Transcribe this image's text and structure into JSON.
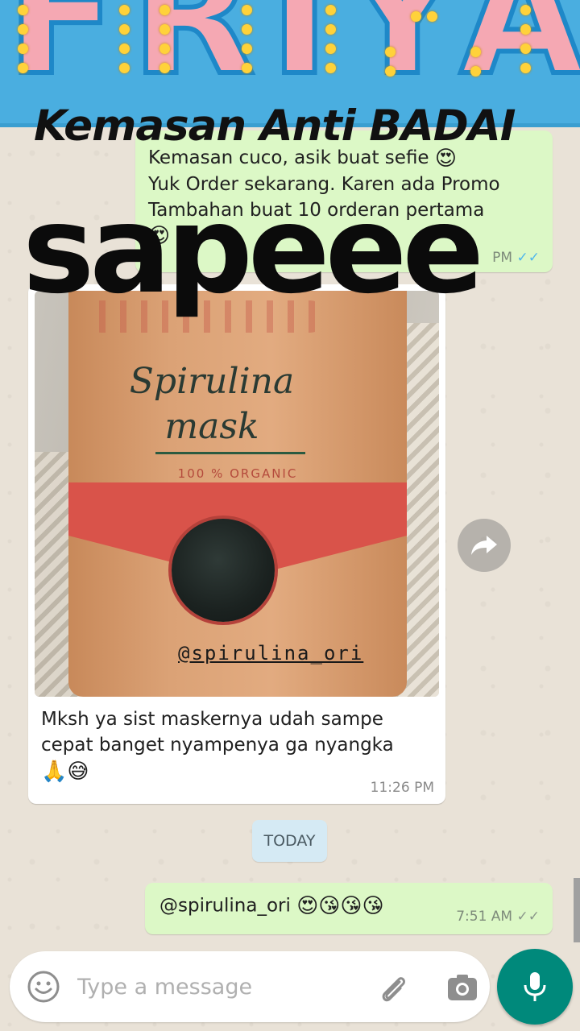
{
  "story": {
    "banner_word": "FRIYAY",
    "headline": "Kemasan Anti BADAI",
    "big_word": "sapeee"
  },
  "chat": {
    "outgoing_top": {
      "line1": "Kemasan cuco, asik buat sefie",
      "line1_emoji": "😍",
      "line2": "Yuk Order sekarang. Karen ada Promo",
      "line3": "Tambahan buat 10 orderan pertama",
      "line4_emoji": "😍",
      "time": "PM",
      "ticks": "✓✓"
    },
    "incoming_image": {
      "photo_title": "Spirulina mask",
      "photo_sub": "100 % ORGANIC",
      "watermark": "@spirulina_ori",
      "caption_line1": "Mksh ya sist maskernya udah sampe",
      "caption_line2": "cepat banget nyampenya ga nyangka",
      "caption_emojis": "🙏😅",
      "time": "11:26 PM"
    },
    "date_chip": "TODAY",
    "outgoing_bottom": {
      "text": "@spirulina_ori",
      "emojis": "😍😘😘😘",
      "time": "7:51 AM",
      "ticks": "✓✓"
    }
  },
  "composer": {
    "placeholder": "Type a message",
    "value": ""
  },
  "icons": {
    "emoji": "smiley-face-icon",
    "attach": "paperclip-icon",
    "camera": "camera-icon",
    "mic": "microphone-icon",
    "forward": "forward-arrow-icon"
  },
  "colors": {
    "outgoing_bubble": "#dcf8c6",
    "incoming_bubble": "#ffffff",
    "mic_button": "#00897b",
    "banner": "#4aaee0",
    "read_ticks": "#4fb6ec"
  }
}
